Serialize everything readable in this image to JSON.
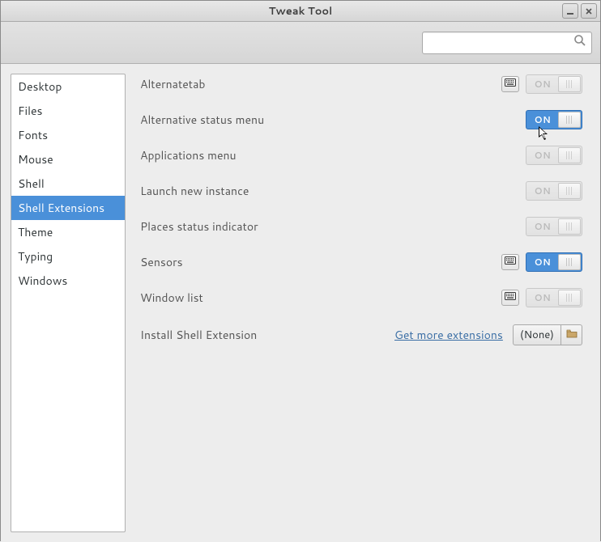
{
  "window": {
    "title": "Tweak Tool"
  },
  "search": {
    "placeholder": ""
  },
  "sidebar": {
    "items": [
      {
        "label": "Desktop",
        "selected": false
      },
      {
        "label": "Files",
        "selected": false
      },
      {
        "label": "Fonts",
        "selected": false
      },
      {
        "label": "Mouse",
        "selected": false
      },
      {
        "label": "Shell",
        "selected": false
      },
      {
        "label": "Shell Extensions",
        "selected": true
      },
      {
        "label": "Theme",
        "selected": false
      },
      {
        "label": "Typing",
        "selected": false
      },
      {
        "label": "Windows",
        "selected": false
      }
    ]
  },
  "extensions": [
    {
      "label": "Alternatetab",
      "has_settings": true,
      "state": "off",
      "switch_label": "ON"
    },
    {
      "label": "Alternative status menu",
      "has_settings": false,
      "state": "on",
      "switch_label": "ON"
    },
    {
      "label": "Applications menu",
      "has_settings": false,
      "state": "off",
      "switch_label": "ON"
    },
    {
      "label": "Launch new instance",
      "has_settings": false,
      "state": "off",
      "switch_label": "ON"
    },
    {
      "label": "Places status indicator",
      "has_settings": false,
      "state": "off",
      "switch_label": "ON"
    },
    {
      "label": "Sensors",
      "has_settings": true,
      "state": "on",
      "switch_label": "ON"
    },
    {
      "label": "Window list",
      "has_settings": true,
      "state": "off",
      "switch_label": "ON"
    }
  ],
  "install": {
    "label": "Install Shell Extension",
    "link": "Get more extensions",
    "button": "(None)"
  }
}
